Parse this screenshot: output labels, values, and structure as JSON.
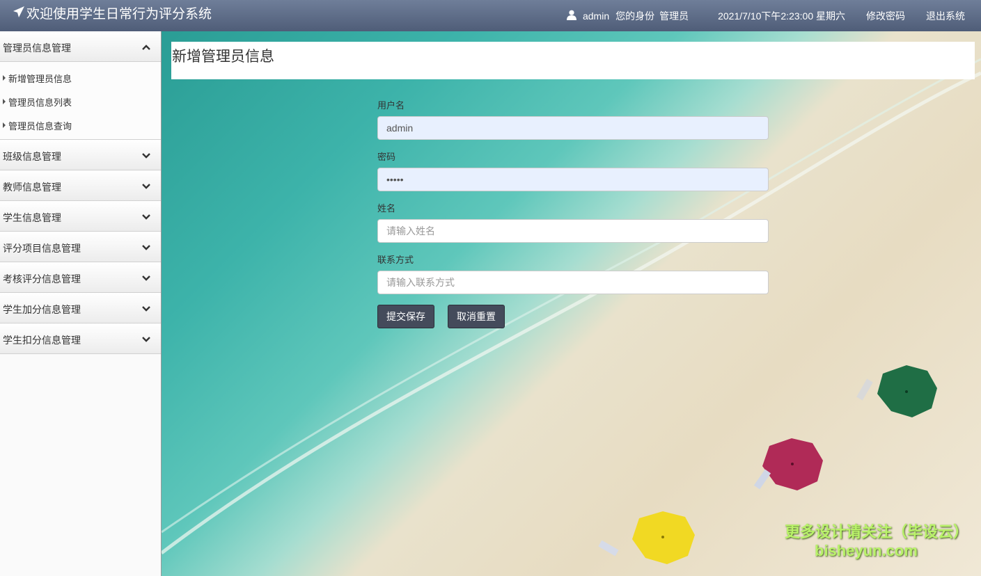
{
  "app": {
    "title": "欢迎使用学生日常行为评分系统"
  },
  "header": {
    "username": "admin",
    "role_label": "您的身份",
    "role_value": "管理员",
    "datetime": "2021/7/10下午2:23:00 星期六",
    "change_password": "修改密码",
    "logout": "退出系统"
  },
  "sidebar": {
    "open_section": {
      "label": "管理员信息管理",
      "items": [
        {
          "label": "新增管理员信息"
        },
        {
          "label": "管理员信息列表"
        },
        {
          "label": "管理员信息查询"
        }
      ]
    },
    "sections": [
      {
        "label": "班级信息管理"
      },
      {
        "label": "教师信息管理"
      },
      {
        "label": "学生信息管理"
      },
      {
        "label": "评分项目信息管理"
      },
      {
        "label": "考核评分信息管理"
      },
      {
        "label": "学生加分信息管理"
      },
      {
        "label": "学生扣分信息管理"
      }
    ]
  },
  "main": {
    "page_title": "新增管理员信息",
    "form": {
      "username": {
        "label": "用户名",
        "value": "admin",
        "placeholder": ""
      },
      "password": {
        "label": "密码",
        "value": "•••••",
        "placeholder": ""
      },
      "name": {
        "label": "姓名",
        "value": "",
        "placeholder": "请输入姓名"
      },
      "contact": {
        "label": "联系方式",
        "value": "",
        "placeholder": "请输入联系方式"
      },
      "submit_label": "提交保存",
      "reset_label": "取消重置"
    }
  },
  "watermark": {
    "line1": "更多设计请关注（毕设云）",
    "line2": "bisheyun.com"
  },
  "colors": {
    "header_top": "#6f7e99",
    "header_bottom": "#4f5d78",
    "button_bg": "#444b5b",
    "autofill_bg": "#e8f0fe",
    "watermark": "#b9f26a"
  }
}
